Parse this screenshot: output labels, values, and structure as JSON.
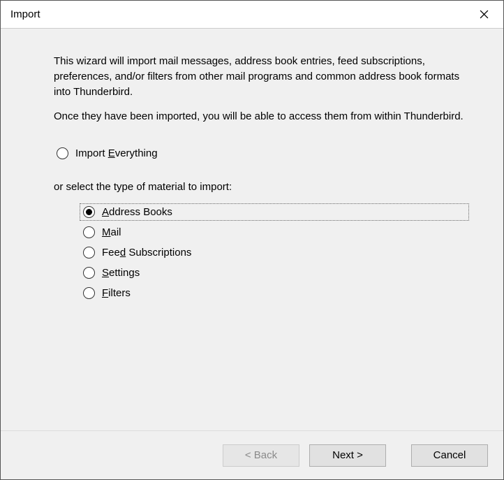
{
  "window": {
    "title": "Import"
  },
  "intro": {
    "para1": "This wizard will import mail messages, address book entries, feed subscriptions, preferences, and/or filters from other mail programs and common address book formats into Thunderbird.",
    "para2": "Once they have been imported, you will be able to access them from within Thunderbird."
  },
  "options": {
    "everything_pre": "Import ",
    "everything_key": "E",
    "everything_post": "verything",
    "or_label": "or select the type of material to import:",
    "items": [
      {
        "pre": "",
        "key": "A",
        "post": "ddress Books",
        "selected": true
      },
      {
        "pre": "",
        "key": "M",
        "post": "ail",
        "selected": false
      },
      {
        "pre": "Fee",
        "key": "d",
        "post": " Subscriptions",
        "selected": false
      },
      {
        "pre": "",
        "key": "S",
        "post": "ettings",
        "selected": false
      },
      {
        "pre": "",
        "key": "F",
        "post": "ilters",
        "selected": false
      }
    ]
  },
  "buttons": {
    "back": "< Back",
    "next": "Next >",
    "cancel": "Cancel"
  }
}
